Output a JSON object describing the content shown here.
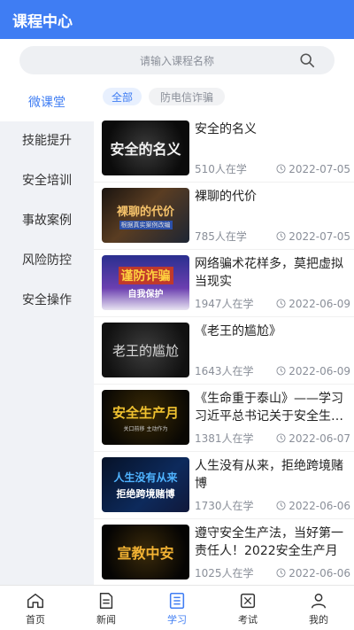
{
  "header": {
    "title": "课程中心"
  },
  "search": {
    "placeholder": "请输入课程名称"
  },
  "sidebar": {
    "items": [
      {
        "label": "微课堂"
      },
      {
        "label": "技能提升"
      },
      {
        "label": "安全培训"
      },
      {
        "label": "事故案例"
      },
      {
        "label": "风险防控"
      },
      {
        "label": "安全操作"
      }
    ]
  },
  "filters": {
    "chips": [
      {
        "label": "全部"
      },
      {
        "label": "防电信诈骗"
      }
    ]
  },
  "courses": [
    {
      "title": "安全的名义",
      "learners": "510人在学",
      "date": "2022-07-05",
      "thumb_text": "安全的名义"
    },
    {
      "title": "裸聊的代价",
      "learners": "785人在学",
      "date": "2022-07-05",
      "thumb_text": "裸聊的代价",
      "thumb_sub": "根据真实案例改编"
    },
    {
      "title": "网络骗术花样多，莫把虚拟当现实",
      "learners": "1947人在学",
      "date": "2022-06-09",
      "thumb_text": "谨防诈骗",
      "thumb_sub": "自我保护"
    },
    {
      "title": "《老王的尴尬》",
      "learners": "1643人在学",
      "date": "2022-06-09",
      "thumb_text": "老王的尴尬"
    },
    {
      "title": "《生命重于泰山》——学习习近平总书记关于安全生产重要论述",
      "learners": "1381人在学",
      "date": "2022-06-07",
      "thumb_text": "安全生产月",
      "thumb_sub": "关口前移 主动作为"
    },
    {
      "title": "人生没有从来，拒绝跨境赌博",
      "learners": "1730人在学",
      "date": "2022-06-06",
      "thumb_text": "人生没有从来",
      "thumb_sub": "拒绝跨境赌博"
    },
    {
      "title": "遵守安全生产法，当好第一责任人！2022安全生产月",
      "learners": "1025人在学",
      "date": "2022-06-06",
      "thumb_text": "宣教中安"
    }
  ],
  "tabbar": {
    "items": [
      {
        "label": "首页",
        "icon": "home-icon"
      },
      {
        "label": "新闻",
        "icon": "news-icon"
      },
      {
        "label": "学习",
        "icon": "study-icon"
      },
      {
        "label": "考试",
        "icon": "exam-icon"
      },
      {
        "label": "我的",
        "icon": "profile-icon"
      }
    ],
    "active": "学习"
  },
  "colors": {
    "accent": "#3f7df3",
    "sidebar_bg": "#f0f2f6",
    "muted_text": "#8a8f99"
  }
}
